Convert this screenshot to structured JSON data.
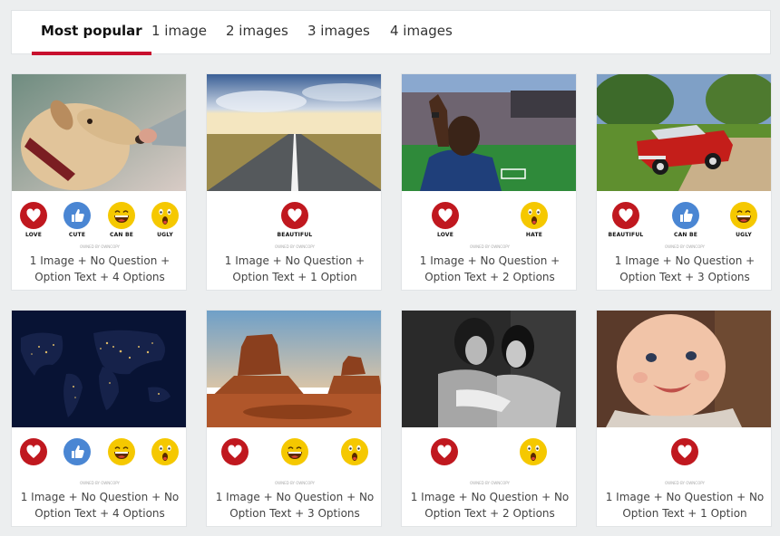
{
  "tabs": [
    {
      "label": "Most popular",
      "active": true
    },
    {
      "label": "1 image",
      "active": false
    },
    {
      "label": "2 images",
      "active": false
    },
    {
      "label": "3 images",
      "active": false
    },
    {
      "label": "4 images",
      "active": false
    }
  ],
  "colors": {
    "accent": "#c8102e",
    "love": "#c0181f",
    "like": "#4a86d3",
    "smiley": "#f5c800"
  },
  "cards": [
    {
      "image": "dog-and-hand-photo",
      "credit": "OWNED BY OWNCOPY",
      "caption": "1 Image + No Question + Option Text + 4 Options",
      "reactions": [
        {
          "icon": "heart-icon",
          "label": "LOVE"
        },
        {
          "icon": "thumbs-up-icon",
          "label": "CUTE"
        },
        {
          "icon": "grin-icon",
          "label": "CAN BE"
        },
        {
          "icon": "shocked-icon",
          "label": "UGLY"
        }
      ]
    },
    {
      "image": "road-to-horizon-photo",
      "credit": "OWNED BY OWNCOPY",
      "caption": "1 Image + No Question + Option Text + 1 Option",
      "reactions": [
        {
          "icon": "heart-icon",
          "label": "BEAUTIFUL"
        }
      ]
    },
    {
      "image": "stadium-fan-photo",
      "credit": "OWNED BY OWNCOPY",
      "caption": "1 Image + No Question + Option Text + 2 Options",
      "reactions": [
        {
          "icon": "heart-icon",
          "label": "LOVE"
        },
        {
          "icon": "shocked-icon",
          "label": "HATE"
        }
      ]
    },
    {
      "image": "red-vintage-car-photo",
      "credit": "OWNED BY OWNCOPY",
      "caption": "1 Image + No Question + Option Text + 3 Options",
      "reactions": [
        {
          "icon": "heart-icon",
          "label": "BEAUTIFUL"
        },
        {
          "icon": "thumbs-up-icon",
          "label": "CAN BE"
        },
        {
          "icon": "grin-icon",
          "label": "UGLY"
        }
      ]
    },
    {
      "image": "earth-at-night-photo",
      "credit": "OWNED BY OWNCOPY",
      "caption": "1 Image + No Question + No Option Text + 4 Options",
      "reactions": [
        {
          "icon": "heart-icon",
          "label": ""
        },
        {
          "icon": "thumbs-up-icon",
          "label": ""
        },
        {
          "icon": "grin-icon",
          "label": ""
        },
        {
          "icon": "shocked-icon",
          "label": ""
        }
      ]
    },
    {
      "image": "desert-buttes-photo",
      "credit": "OWNED BY OWNCOPY",
      "caption": "1 Image + No Question + No Option Text + 3 Options",
      "reactions": [
        {
          "icon": "heart-icon",
          "label": ""
        },
        {
          "icon": "grin-icon",
          "label": ""
        },
        {
          "icon": "shocked-icon",
          "label": ""
        }
      ]
    },
    {
      "image": "two-women-bw-photo",
      "credit": "OWNED BY OWNCOPY",
      "caption": "1 Image + No Question + No Option Text + 2 Options",
      "reactions": [
        {
          "icon": "heart-icon",
          "label": ""
        },
        {
          "icon": "shocked-icon",
          "label": ""
        }
      ]
    },
    {
      "image": "smiling-baby-photo",
      "credit": "OWNED BY OWNCOPY",
      "caption": "1 Image + No Question + No Option Text + 1 Option",
      "reactions": [
        {
          "icon": "heart-icon",
          "label": ""
        }
      ]
    }
  ]
}
